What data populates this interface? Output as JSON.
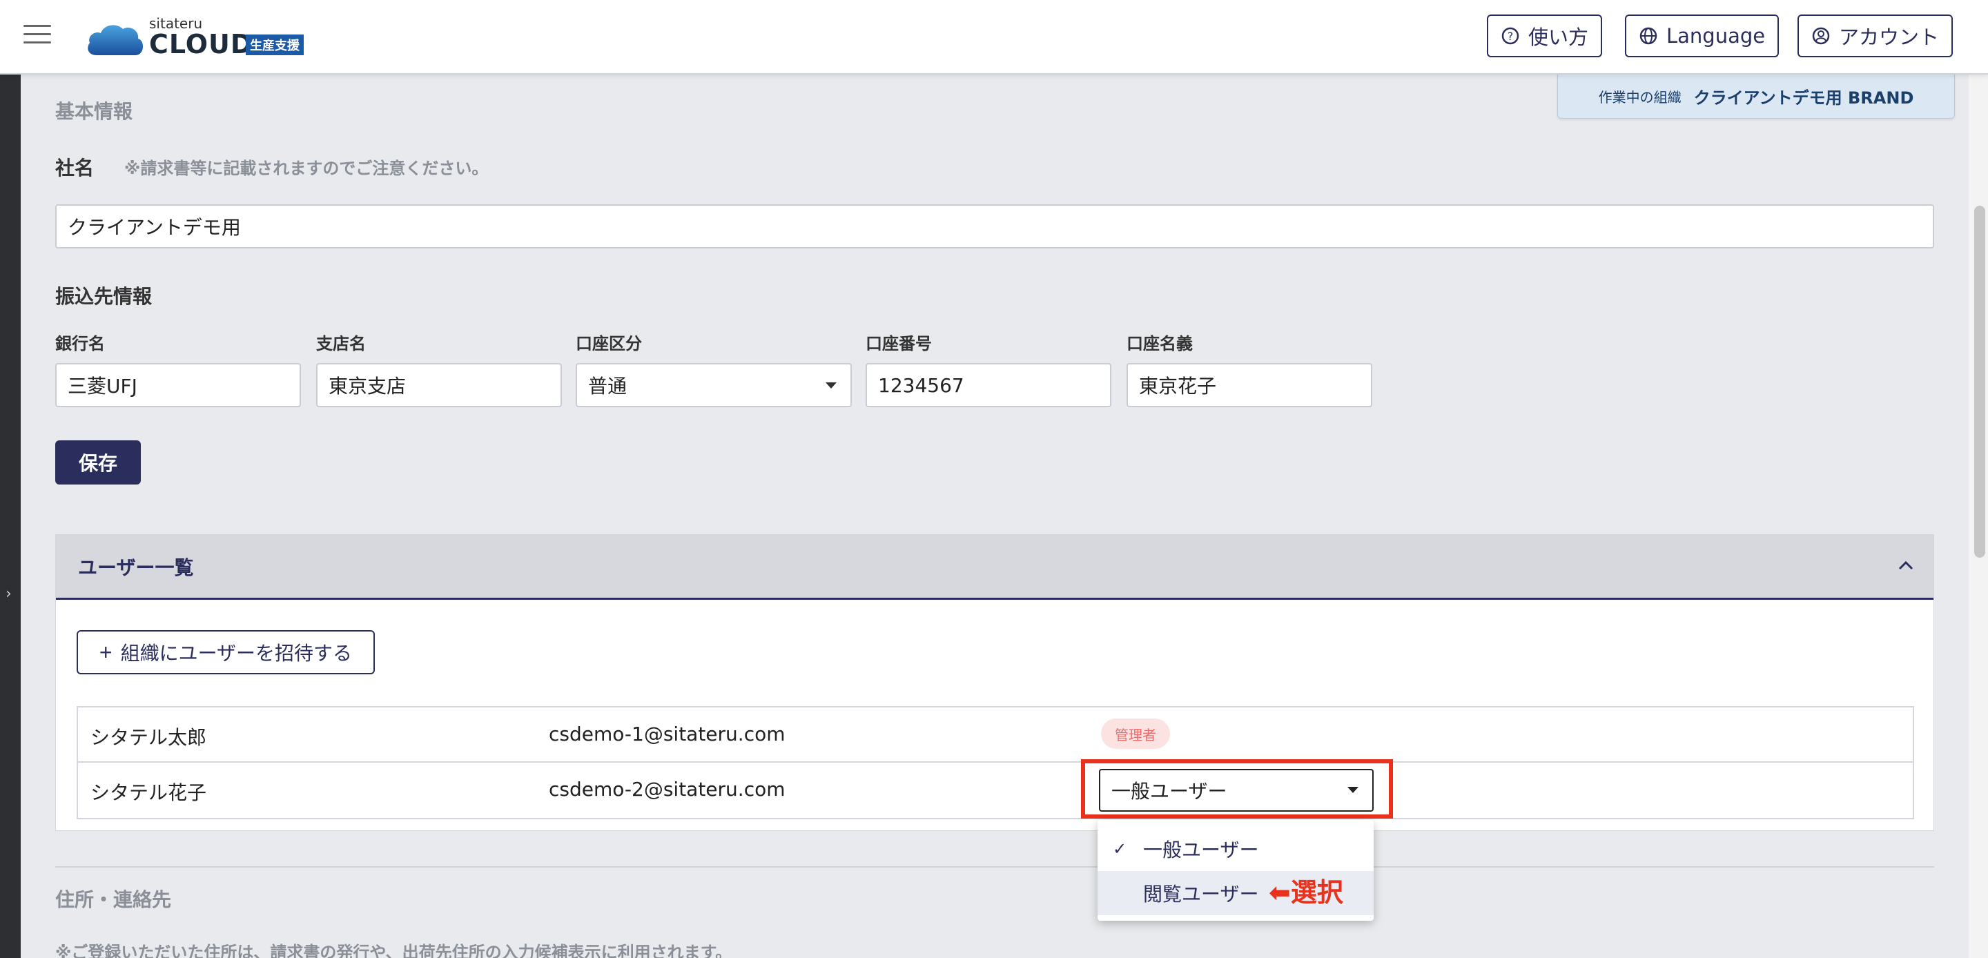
{
  "header": {
    "logo_small": "sitateru",
    "logo_main": "CLOUD",
    "logo_badge": "生産支援",
    "help_label": "使い方",
    "language_label": "Language",
    "account_label": "アカウント"
  },
  "org_tag": {
    "label": "作業中の組織",
    "name": "クライアントデモ用 BRAND"
  },
  "basic_info": {
    "section_title": "基本情報",
    "company_label": "社名",
    "company_note": "※請求書等に記載されますのでご注意ください。",
    "company_value": "クライアントデモ用",
    "bank_section_title": "振込先情報",
    "bank_name_label": "銀行名",
    "bank_name_value": "三菱UFJ",
    "branch_label": "支店名",
    "branch_value": "東京支店",
    "account_type_label": "口座区分",
    "account_type_value": "普通",
    "account_number_label": "口座番号",
    "account_number_value": "1234567",
    "account_holder_label": "口座名義",
    "account_holder_value": "東京花子",
    "save_label": "保存"
  },
  "users": {
    "title": "ユーザー一覧",
    "invite_label": "組織にユーザーを招待する",
    "rows": [
      {
        "name": "シタテル太郎",
        "email": "csdemo-1@sitateru.com",
        "role_badge": "管理者"
      },
      {
        "name": "シタテル花子",
        "email": "csdemo-2@sitateru.com",
        "role_value": "一般ユーザー"
      }
    ],
    "role_options": [
      "一般ユーザー",
      "閲覧ユーザー"
    ],
    "annotation": "⬅選択"
  },
  "address": {
    "section_title": "住所・連絡先",
    "note": "※ご登録いただいた住所は、請求書の発行や、出荷先住所の入力候補表示に利用されます。"
  }
}
